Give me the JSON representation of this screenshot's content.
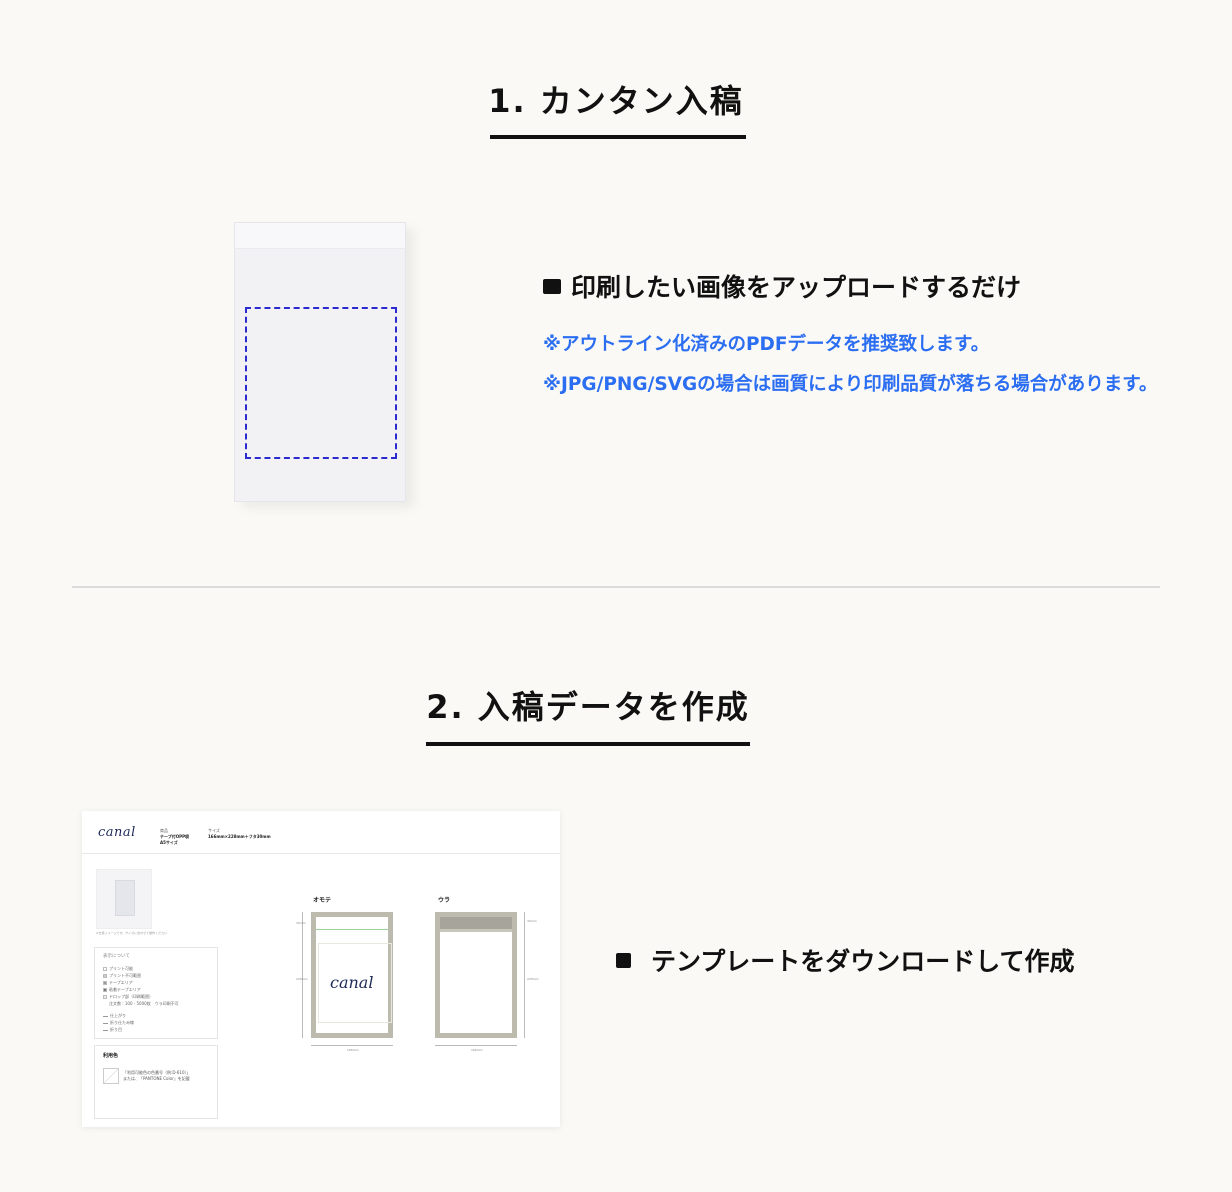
{
  "section1": {
    "title": "1. カンタン入稿",
    "heading": "印刷したい画像をアップロードするだけ",
    "notes": [
      "※アウトライン化済みのPDFデータを推奨致します。",
      "※JPG/PNG/SVGの場合は画質により印刷品質が落ちる場合があります。"
    ]
  },
  "section2": {
    "title": "2. 入稿データを作成",
    "heading": "テンプレートをダウンロードして作成",
    "template": {
      "logo": "canal",
      "product_label": "商品",
      "product_name": "テープ付OPP袋",
      "product_size_name": "A5サイズ",
      "size_label": "サイズ",
      "size_value": "166mm×228mm＋フタ30mm",
      "thumb_caption": "※仕様イメージです。サイズに合わせて制作ください",
      "legend_title": "表示について",
      "legend_items": [
        "プリント可能",
        "プリント不可範囲",
        "テープエリア",
        "粘着テープエリア",
        "ドロップ部（印刷範囲）",
        "注文数 : 100 - 5000枚　ウラ印刷不可",
        "仕上がり",
        "折り仕たみ線",
        "折り目"
      ],
      "color_title": "利用色",
      "color_note_1": "「利用可能色の色番号（例:D-610）」",
      "color_note_2": "または、「PANTONE Color」を記載",
      "front_label": "オモテ",
      "back_label": "ウラ",
      "front_logo": "canal",
      "dim_width": "166mm",
      "dim_height": "228mm",
      "dim_flap": "30mm"
    }
  }
}
